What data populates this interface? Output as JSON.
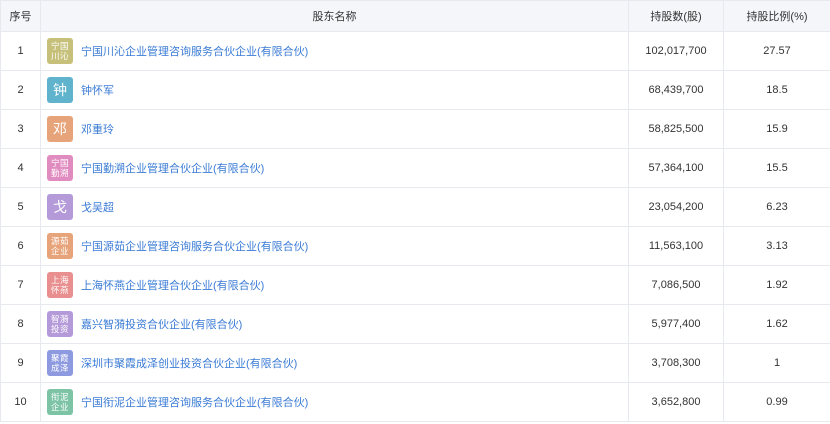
{
  "headers": {
    "rank": "序号",
    "name": "股东名称",
    "shares": "持股数(股)",
    "ratio": "持股比例(%)"
  },
  "rows": [
    {
      "rank": "1",
      "avatar": "宁国川沁",
      "avatar_color": "#c6c07a",
      "name": "宁国川沁企业管理咨询服务合伙企业(有限合伙)",
      "shares": "102,017,700",
      "ratio": "27.57"
    },
    {
      "rank": "2",
      "avatar": "钟",
      "avatar_color": "#5fb3cc",
      "name": "钟怀军",
      "shares": "68,439,700",
      "ratio": "18.5"
    },
    {
      "rank": "3",
      "avatar": "邓",
      "avatar_color": "#e7a37a",
      "name": "邓重玲",
      "shares": "58,825,500",
      "ratio": "15.9"
    },
    {
      "rank": "4",
      "avatar": "宁国勤溯",
      "avatar_color": "#e18cc0",
      "name": "宁国勤溯企业管理合伙企业(有限合伙)",
      "shares": "57,364,100",
      "ratio": "15.5"
    },
    {
      "rank": "5",
      "avatar": "戈",
      "avatar_color": "#b49ad8",
      "name": "戈吴超",
      "shares": "23,054,200",
      "ratio": "6.23"
    },
    {
      "rank": "6",
      "avatar": "源茹企业",
      "avatar_color": "#e7a37a",
      "name": "宁国源茹企业管理咨询服务合伙企业(有限合伙)",
      "shares": "11,563,100",
      "ratio": "3.13"
    },
    {
      "rank": "7",
      "avatar": "上海怀燕",
      "avatar_color": "#ea8f8f",
      "name": "上海怀燕企业管理合伙企业(有限合伙)",
      "shares": "7,086,500",
      "ratio": "1.92"
    },
    {
      "rank": "8",
      "avatar": "智漪投资",
      "avatar_color": "#b49ad8",
      "name": "嘉兴智漪投资合伙企业(有限合伙)",
      "shares": "5,977,400",
      "ratio": "1.62"
    },
    {
      "rank": "9",
      "avatar": "聚霞成泽",
      "avatar_color": "#8e9ae0",
      "name": "深圳市聚霞成泽创业投资合伙企业(有限合伙)",
      "shares": "3,708,300",
      "ratio": "1"
    },
    {
      "rank": "10",
      "avatar": "衔泥企业",
      "avatar_color": "#7dc3a6",
      "name": "宁国衔泥企业管理咨询服务合伙企业(有限合伙)",
      "shares": "3,652,800",
      "ratio": "0.99"
    }
  ]
}
